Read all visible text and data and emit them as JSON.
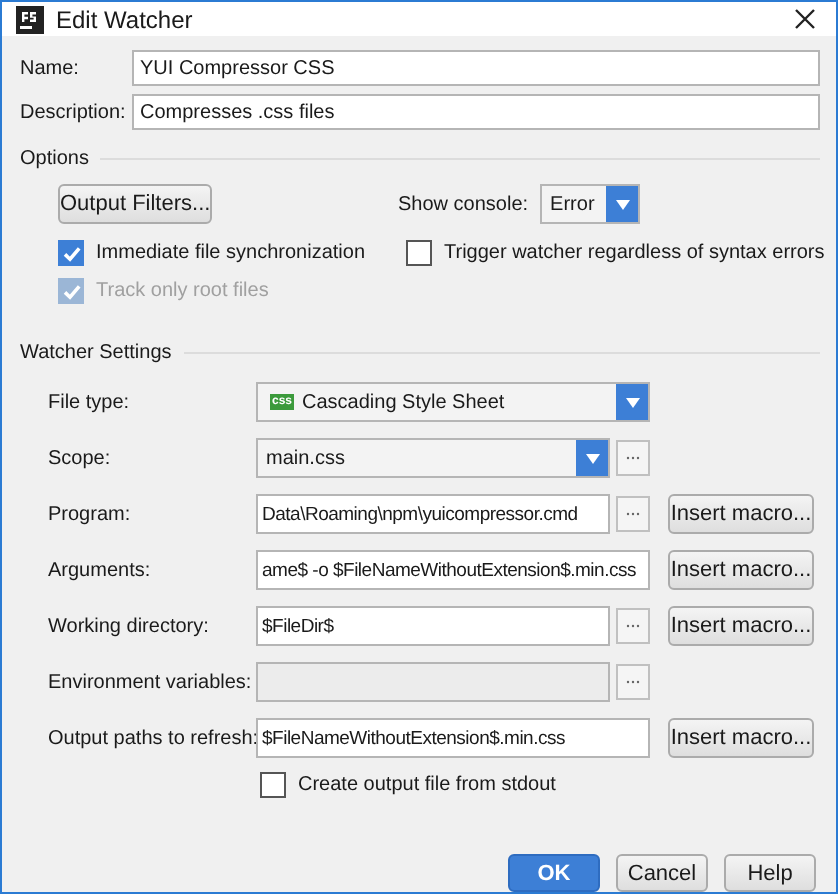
{
  "window": {
    "title": "Edit Watcher"
  },
  "fields": [
    {
      "label": "Name:",
      "value": "YUI Compressor CSS"
    },
    {
      "label": "Description:",
      "value": "Compresses .css files"
    }
  ],
  "options": {
    "heading": "Options",
    "output_filters_button": "Output Filters...",
    "show_console": {
      "label": "Show console:",
      "value": "Error"
    },
    "checkboxes": [
      {
        "label": "Immediate file synchronization",
        "checked": true,
        "disabled": false
      },
      {
        "label": "Trigger watcher regardless of syntax errors",
        "checked": false,
        "disabled": false
      },
      {
        "label": "Track only root files",
        "checked": true,
        "disabled": true
      }
    ]
  },
  "watcher_settings": {
    "heading": "Watcher Settings",
    "rows": [
      {
        "kind": "dropdown",
        "label": "File type:",
        "value": "Cascading Style Sheet",
        "icon_text": "css",
        "browse": false
      },
      {
        "kind": "dropdown",
        "label": "Scope:",
        "value": "main.css",
        "browse": true
      },
      {
        "kind": "input",
        "label": "Program:",
        "value": "Data\\Roaming\\npm\\yuicompressor.cmd",
        "browse": true,
        "macro_button": "Insert macro...",
        "disabled": false
      },
      {
        "kind": "input",
        "label": "Arguments:",
        "value": "ame$ -o $FileNameWithoutExtension$.min.css",
        "browse": false,
        "macro_button": "Insert macro...",
        "disabled": false
      },
      {
        "kind": "input",
        "label": "Working directory:",
        "value": "$FileDir$",
        "browse": true,
        "macro_button": "Insert macro...",
        "disabled": false
      },
      {
        "kind": "input",
        "label": "Environment variables:",
        "browse": true,
        "disabled": true
      },
      {
        "kind": "input",
        "label": "Output paths to refresh:",
        "value": "$FileNameWithoutExtension$.min.css",
        "browse": false,
        "macro_button": "Insert macro...",
        "disabled": false
      }
    ],
    "stdout_checkbox": {
      "label": "Create output file from stdout",
      "checked": false
    }
  },
  "buttons": [
    {
      "label": "OK",
      "primary": true
    },
    {
      "label": "Cancel",
      "primary": false
    },
    {
      "label": "Help",
      "primary": false
    }
  ]
}
